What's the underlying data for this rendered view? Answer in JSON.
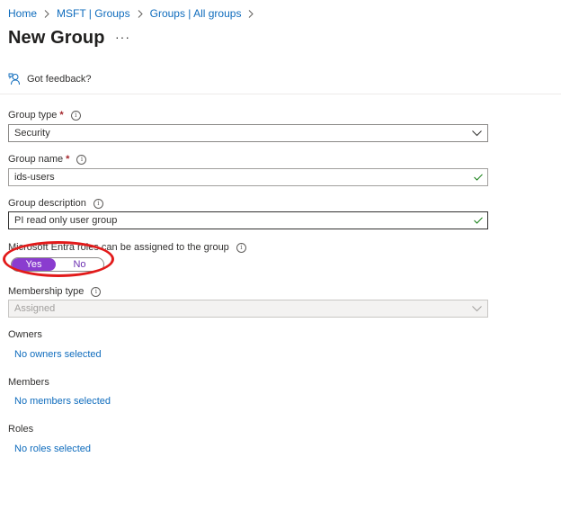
{
  "breadcrumb": {
    "items": [
      {
        "label": "Home"
      },
      {
        "label": "MSFT | Groups"
      },
      {
        "label": "Groups | All groups"
      }
    ]
  },
  "page": {
    "title": "New Group",
    "more_label": "···"
  },
  "toolbar": {
    "feedback_label": "Got feedback?"
  },
  "form": {
    "group_type": {
      "label": "Group type",
      "required_mark": "*",
      "value": "Security"
    },
    "group_name": {
      "label": "Group name",
      "required_mark": "*",
      "value": "ids-users"
    },
    "group_description": {
      "label": "Group description",
      "value": "PI read only user group"
    },
    "roles_assignable": {
      "label": "Microsoft Entra roles can be assigned to the group",
      "yes_label": "Yes",
      "no_label": "No",
      "selected": "Yes"
    },
    "membership_type": {
      "label": "Membership type",
      "value": "Assigned"
    },
    "owners": {
      "label": "Owners",
      "link": "No owners selected"
    },
    "members": {
      "label": "Members",
      "link": "No members selected"
    },
    "roles": {
      "label": "Roles",
      "link": "No roles selected"
    }
  },
  "colors": {
    "link": "#0f6cbd",
    "toggle_selected": "#8a3ccf",
    "annotation": "#e21a1a",
    "valid_check": "#107c10"
  },
  "icons": {
    "feedback": "feedback-person-icon",
    "info": "info-icon",
    "chevron": "chevron-down-icon",
    "check": "checkmark-icon",
    "breadcrumb_sep": "chevron-right-icon"
  }
}
